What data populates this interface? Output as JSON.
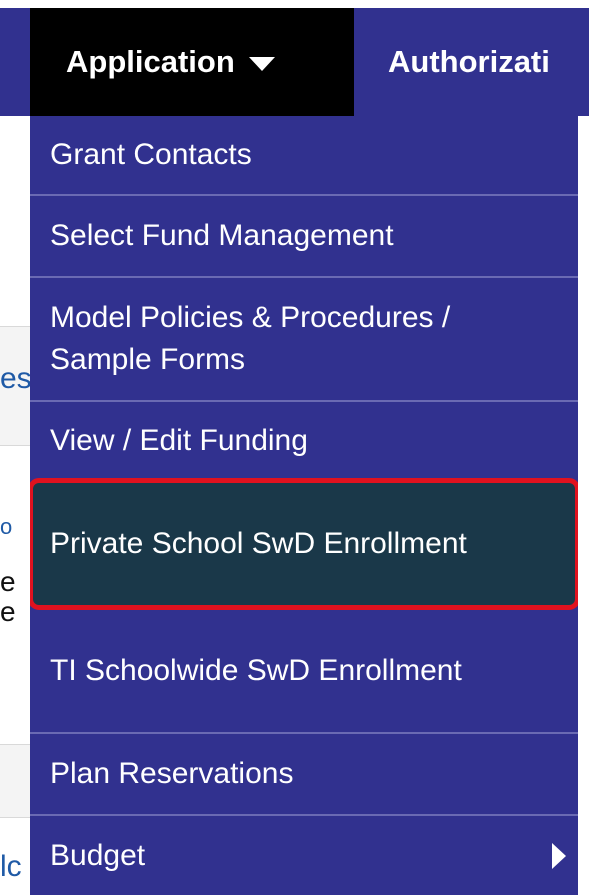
{
  "nav": {
    "active_item": "Application",
    "next_item": "Authorizati"
  },
  "menu": {
    "items": [
      {
        "label": "Grant Contacts"
      },
      {
        "label": "Select Fund Management"
      },
      {
        "label": "Model Policies & Procedures / Sample Forms"
      },
      {
        "label": "View / Edit Funding"
      },
      {
        "label": "Private School SwD Enrollment"
      },
      {
        "label": "TI Schoolwide SwD Enrollment"
      },
      {
        "label": "Plan Reservations"
      },
      {
        "label": "Budget"
      }
    ]
  },
  "background": {
    "fragments": [
      "es",
      "o",
      "e",
      "e",
      "lc"
    ]
  },
  "colors": {
    "nav_bg": "#31318f",
    "active_bg": "#000000",
    "highlight_bg": "#1a3849",
    "highlight_outline": "#e0121f"
  }
}
